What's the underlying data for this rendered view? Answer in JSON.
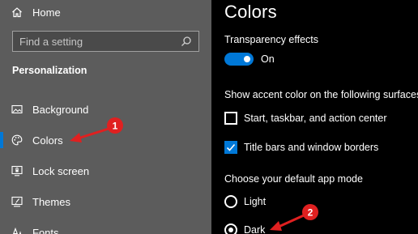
{
  "sidebar": {
    "home_label": "Home",
    "search_placeholder": "Find a setting",
    "section_title": "Personalization",
    "items": [
      {
        "label": "Background",
        "icon": "picture-icon"
      },
      {
        "label": "Colors",
        "icon": "palette-icon",
        "selected": true
      },
      {
        "label": "Lock screen",
        "icon": "lock-screen-icon"
      },
      {
        "label": "Themes",
        "icon": "brush-icon"
      },
      {
        "label": "Fonts",
        "icon": "font-icon"
      }
    ]
  },
  "content": {
    "title": "Colors",
    "transparency": {
      "label": "Transparency effects",
      "state": "On",
      "on": true
    },
    "accent_surfaces": {
      "label": "Show accent color on the following surfaces",
      "options": [
        {
          "label": "Start, taskbar, and action center",
          "checked": false
        },
        {
          "label": "Title bars and window borders",
          "checked": true
        }
      ]
    },
    "app_mode": {
      "label": "Choose your default app mode",
      "options": [
        {
          "label": "Light",
          "selected": false
        },
        {
          "label": "Dark",
          "selected": true
        }
      ]
    }
  },
  "annotations": [
    {
      "number": "1",
      "target": "Colors"
    },
    {
      "number": "2",
      "target": "Dark"
    }
  ],
  "colors": {
    "accent": "#0078d7",
    "annotation_red": "#e02020",
    "sidebar_bg": "#5c5c5c",
    "content_bg": "#000000"
  }
}
